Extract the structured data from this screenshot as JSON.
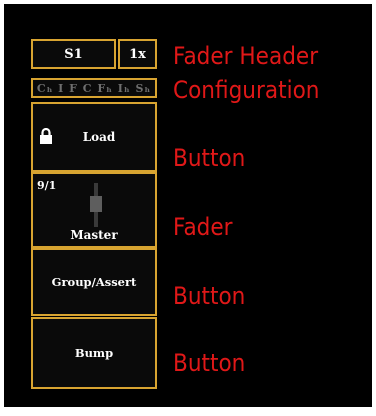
{
  "fader_header": {
    "page_label": "S1",
    "rate_label": "1x",
    "config_indicators": "Cₕ I  F  C Fₕ Iₕ Sₕ"
  },
  "buttons": {
    "load_label": "Load",
    "group_assert_label": "Group/Assert",
    "bump_label": "Bump"
  },
  "fader": {
    "number_label": "9/1",
    "name_label": "Master"
  },
  "legend": {
    "fader_header_line1": "Fader Header",
    "fader_header_line2": "Configuration",
    "button_1": "Button",
    "fader": "Fader",
    "button_2": "Button",
    "button_3": "Button"
  },
  "colors": {
    "border_gold": "#d8a431",
    "legend_red": "#e01818",
    "panel_black": "#000000",
    "dim_gray": "#6f6f6f"
  },
  "icons": {
    "load_icon": "lock-icon",
    "fader_icon": "fader-slider-icon"
  }
}
